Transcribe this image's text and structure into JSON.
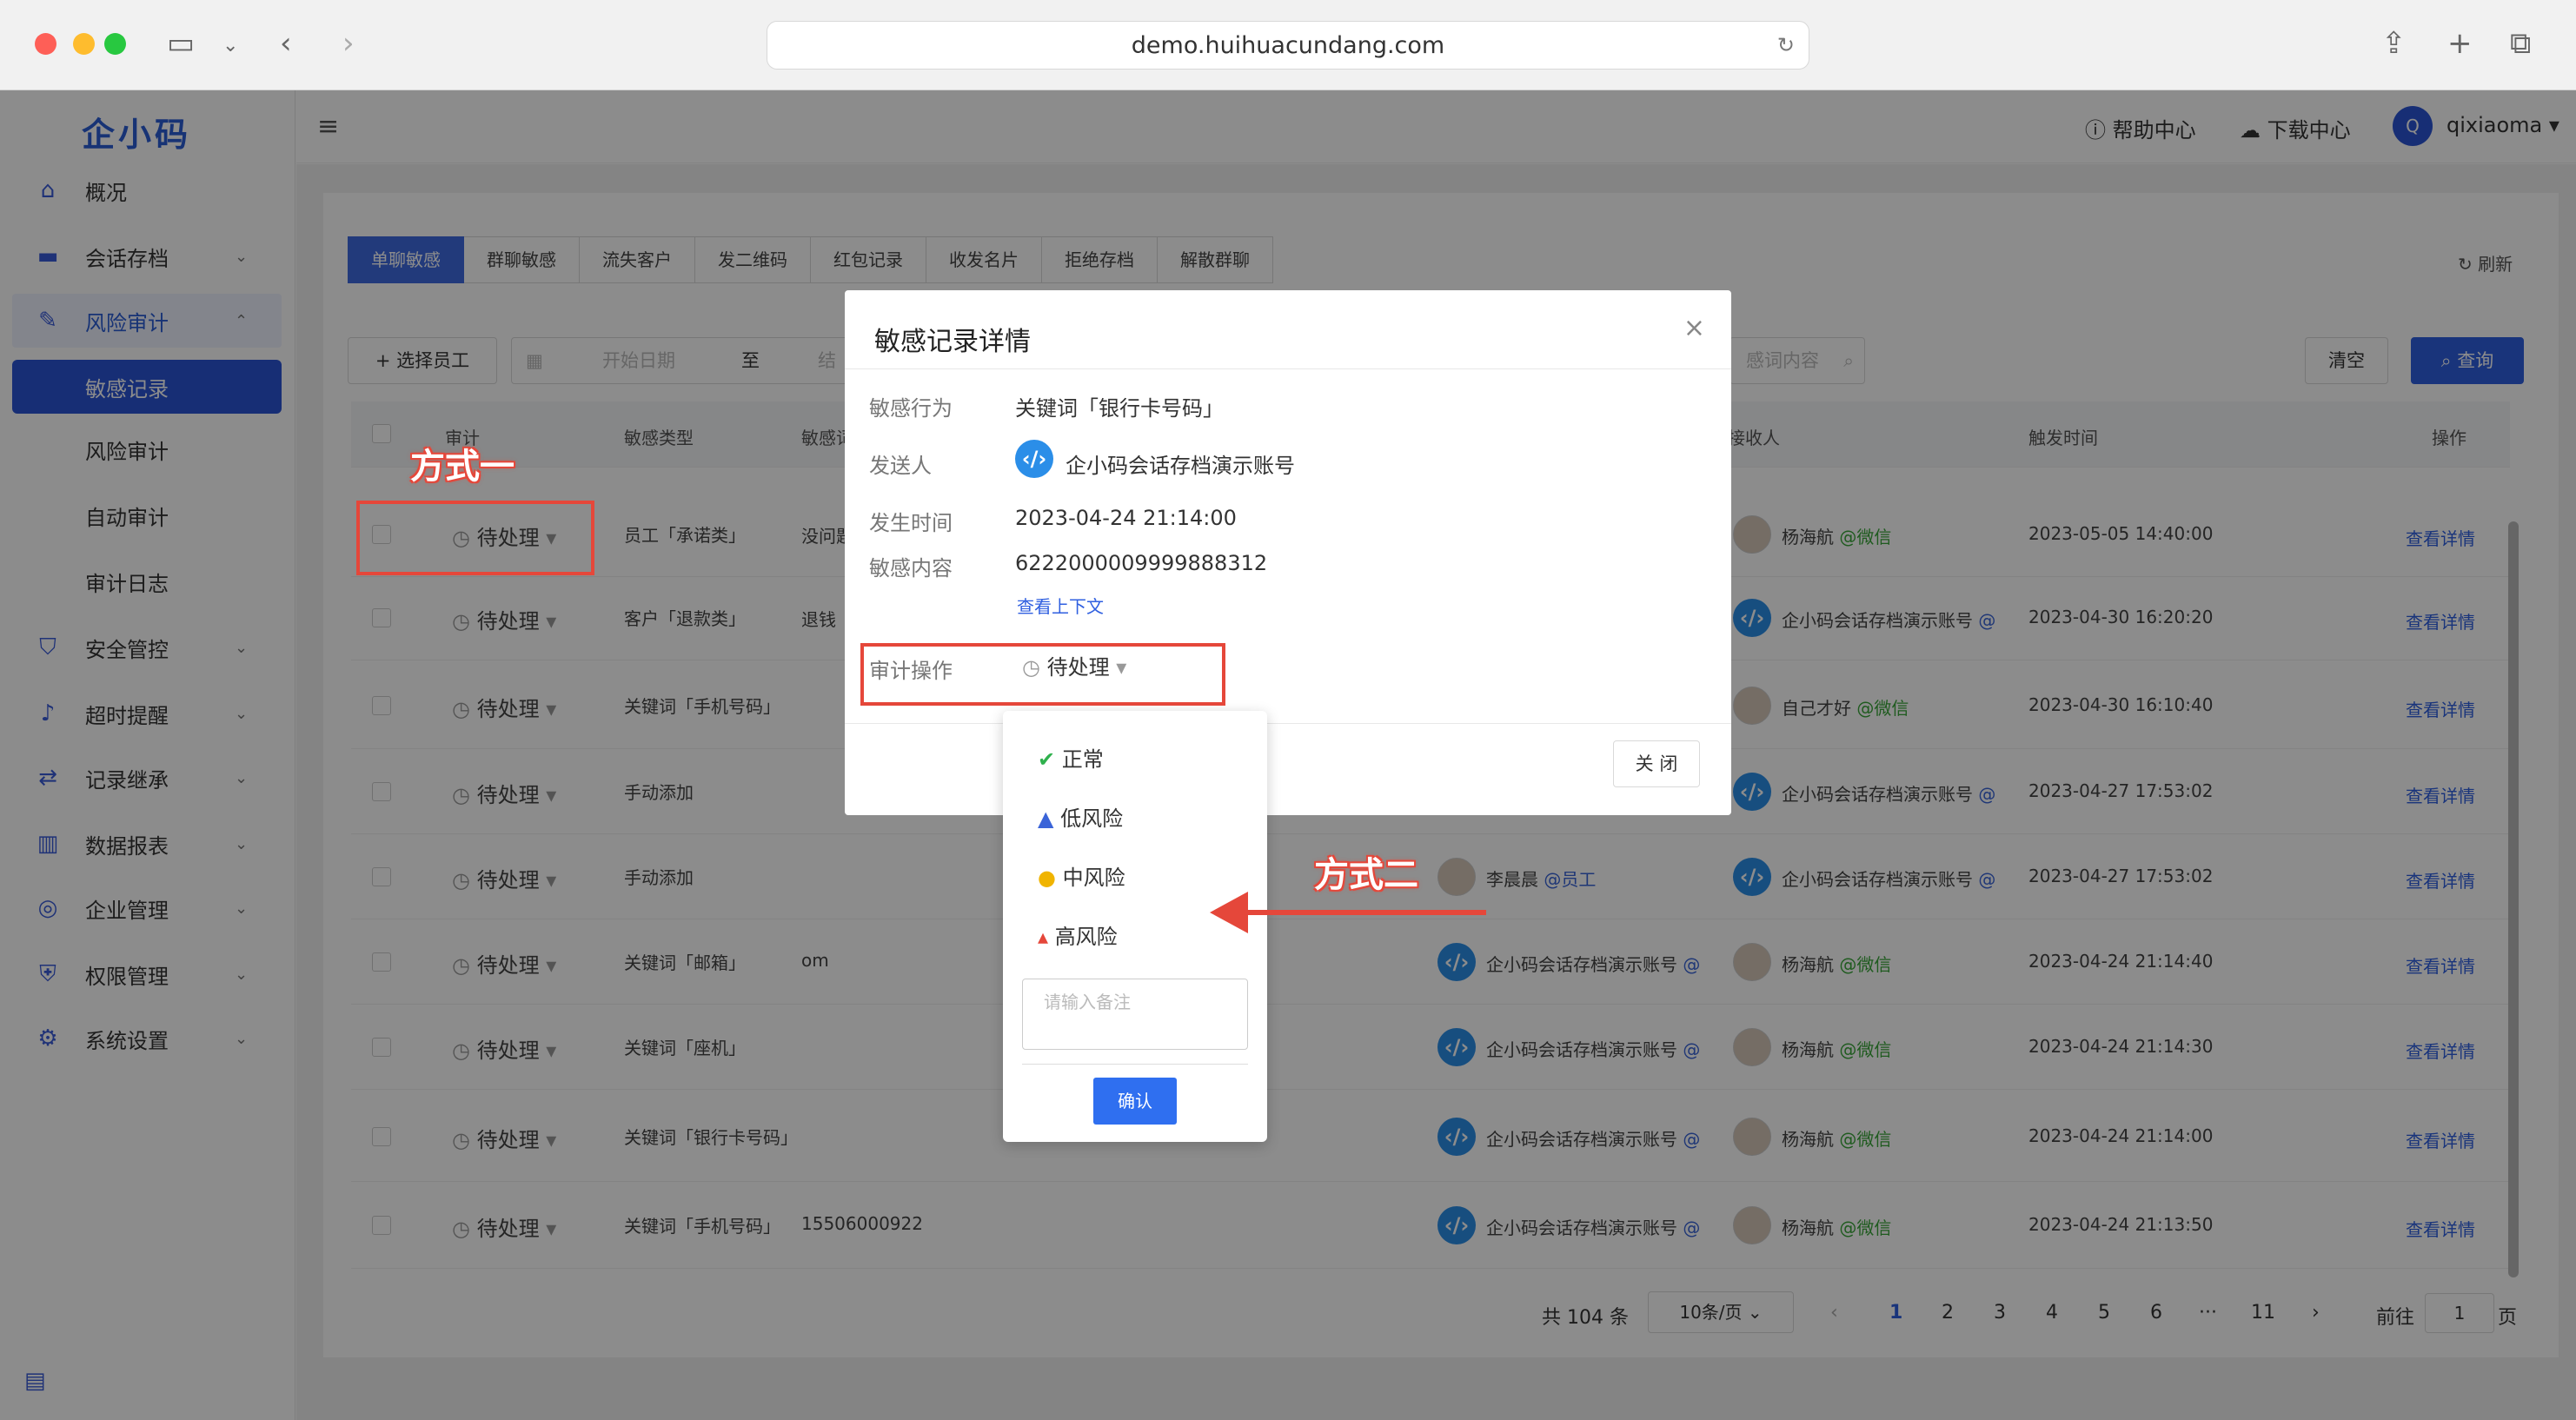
{
  "browser": {
    "url": "demo.huihuacundang.com"
  },
  "app": {
    "logo": "企小码",
    "header": {
      "help": "帮助中心",
      "download": "下载中心",
      "user": "qixiaoma",
      "user_initial": "Q"
    },
    "sidebar": [
      {
        "label": "概况",
        "icon": "home-icon"
      },
      {
        "label": "会话存档",
        "icon": "folder-icon"
      },
      {
        "label": "风险审计",
        "icon": "edit-icon"
      },
      {
        "label": "敏感记录"
      },
      {
        "label": "风险审计"
      },
      {
        "label": "自动审计"
      },
      {
        "label": "审计日志"
      },
      {
        "label": "安全管控",
        "icon": "shield-icon"
      },
      {
        "label": "超时提醒",
        "icon": "bell-icon"
      },
      {
        "label": "记录继承",
        "icon": "inherit-icon"
      },
      {
        "label": "数据报表",
        "icon": "chart-icon"
      },
      {
        "label": "企业管理",
        "icon": "company-icon"
      },
      {
        "label": "权限管理",
        "icon": "lock-icon"
      },
      {
        "label": "系统设置",
        "icon": "gear-icon"
      }
    ],
    "tabs": [
      "单聊敏感",
      "群聊敏感",
      "流失客户",
      "发二维码",
      "红包记录",
      "收发名片",
      "拒绝存档",
      "解散群聊"
    ],
    "refresh": "刷新",
    "filters": {
      "select_staff": "选择员工",
      "start_date": "开始日期",
      "to": "至",
      "end_date": "结",
      "keyword": "感词内容",
      "clear": "清空",
      "search": "查询"
    },
    "table": {
      "headers": [
        "审计",
        "敏感类型",
        "敏感词",
        "接收人",
        "触发时间",
        "操作"
      ],
      "rows": [
        {
          "status": "待处理",
          "type": "员工「承诺类」",
          "word": "没问题",
          "sender": "",
          "receiver": "杨海航",
          "receiver_tag": "@微信",
          "time": "2023-05-05 14:40:00",
          "action": "查看详情"
        },
        {
          "status": "待处理",
          "type": "客户「退款类」",
          "word": "退钱",
          "sender": "",
          "receiver": "企小码会话存档演示账号",
          "receiver_tag": "@",
          "time": "2023-04-30 16:20:20",
          "action": "查看详情"
        },
        {
          "status": "待处理",
          "type": "关键词「手机号码」",
          "word": "",
          "sender": "",
          "receiver": "自己才好",
          "receiver_tag": "@微信",
          "time": "2023-04-30 16:10:40",
          "action": "查看详情"
        },
        {
          "status": "待处理",
          "type": "手动添加",
          "word": "",
          "sender": "",
          "receiver": "企小码会话存档演示账号",
          "receiver_tag": "@",
          "time": "2023-04-27 17:53:02",
          "action": "查看详情"
        },
        {
          "status": "待处理",
          "type": "手动添加",
          "word": "",
          "sender": "李晨晨",
          "sender_tag": "@员工",
          "receiver": "企小码会话存档演示账号",
          "receiver_tag": "@",
          "time": "2023-04-27 17:53:02",
          "action": "查看详情"
        },
        {
          "status": "待处理",
          "type": "关键词「邮箱」",
          "word": "om",
          "sender": "企小码会话存档演示账号",
          "sender_tag": "@",
          "receiver": "杨海航",
          "receiver_tag": "@微信",
          "time": "2023-04-24 21:14:40",
          "action": "查看详情"
        },
        {
          "status": "待处理",
          "type": "关键词「座机」",
          "word": "",
          "sender": "企小码会话存档演示账号",
          "sender_tag": "@",
          "receiver": "杨海航",
          "receiver_tag": "@微信",
          "time": "2023-04-24 21:14:30",
          "action": "查看详情"
        },
        {
          "status": "待处理",
          "type": "关键词「银行卡号码」",
          "word": "",
          "sender": "企小码会话存档演示账号",
          "sender_tag": "@",
          "receiver": "杨海航",
          "receiver_tag": "@微信",
          "time": "2023-04-24 21:14:00",
          "action": "查看详情"
        },
        {
          "status": "待处理",
          "type": "关键词「手机号码」",
          "word": "15506000922",
          "sender": "企小码会话存档演示账号",
          "sender_tag": "@",
          "receiver": "杨海航",
          "receiver_tag": "@微信",
          "time": "2023-04-24 21:13:50",
          "action": "查看详情"
        }
      ]
    },
    "pagination": {
      "total": "共 104 条",
      "page_size": "10条/页",
      "pages": [
        "1",
        "2",
        "3",
        "4",
        "5",
        "6",
        "···",
        "11"
      ],
      "goto": "前往",
      "goto_value": "1",
      "page_unit": "页",
      "prev": "‹",
      "next": "›"
    }
  },
  "modal": {
    "title": "敏感记录详情",
    "close": "×",
    "fields": {
      "behavior_label": "敏感行为",
      "behavior": "关键词「银行卡号码」",
      "sender_label": "发送人",
      "sender": "企小码会话存档演示账号",
      "time_label": "发生时间",
      "time": "2023-04-24 21:14:00",
      "content_label": "敏感内容",
      "content": "6222000009999888312",
      "context_link": "查看上下文",
      "audit_label": "审计操作",
      "audit_status": "待处理"
    },
    "close_button": "关 闭"
  },
  "dropdown": {
    "options": [
      {
        "label": "正常",
        "icon": "check-circle-icon",
        "color": "#2fb14d"
      },
      {
        "label": "低风险",
        "icon": "warning-triangle-icon",
        "color": "#3a64d8"
      },
      {
        "label": "中风险",
        "icon": "bolt-circle-icon",
        "color": "#f0b400"
      },
      {
        "label": "高风险",
        "icon": "alarm-icon",
        "color": "#e5473a"
      }
    ],
    "remark_placeholder": "请输入备注",
    "confirm": "确认"
  },
  "annotations": {
    "method1": "方式一",
    "method2": "方式二"
  },
  "colors": {
    "brand": "#2b55d6",
    "annotation": "#e5473a"
  }
}
